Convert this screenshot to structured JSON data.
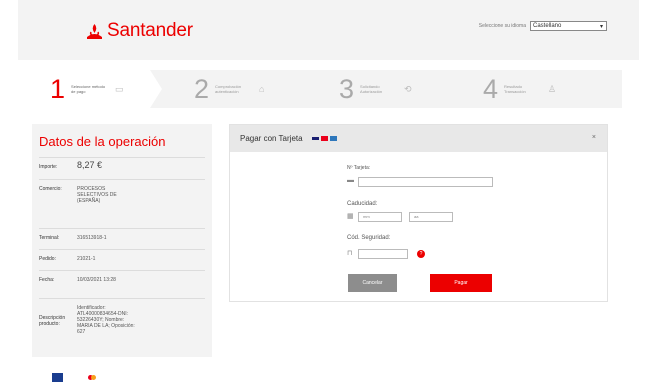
{
  "header": {
    "brand": "Santander",
    "language_label": "Seleccione su idioma",
    "language_value": "Castellano",
    "brand_color": "#ec0000"
  },
  "steps": [
    {
      "number": "1",
      "text": "Seleccione método de pago",
      "icon": "card-icon",
      "active": true
    },
    {
      "number": "2",
      "text": "Comprobación autenticación",
      "icon": "lock-icon",
      "active": false
    },
    {
      "number": "3",
      "text": "Solicitando Autorización",
      "icon": "refresh-icon",
      "active": false
    },
    {
      "number": "4",
      "text": "Resultado Transacción",
      "icon": "thumbs-up-icon",
      "active": false
    }
  ],
  "operation": {
    "title": "Datos de la operación",
    "rows": [
      {
        "label": "Importe:",
        "value": "8,27 €"
      },
      {
        "label": "Comercio:",
        "value": "PROCESOS SELECTIVOS DE (ESPAÑA)"
      },
      {
        "label": "Terminal:",
        "value": "316513918-1"
      },
      {
        "label": "Pedido:",
        "value": "21021-1"
      },
      {
        "label": "Fecha:",
        "value": "10/03/2021  13:28"
      },
      {
        "label": "Descripción producto:",
        "value": "Identificador: ATL40000834654-DNI: 53226430Y; Nombre: MARIA DE LA; Oposición: 627"
      }
    ]
  },
  "payment": {
    "title": "Pagar con Tarjeta",
    "card_number_label": "Nº Tarjeta:",
    "card_number_value": "",
    "expiry_label": "Caducidad:",
    "expiry_month_placeholder": "mm",
    "expiry_year_placeholder": "aa",
    "cvv_label": "Cód. Seguridad:",
    "cvv_value": "",
    "cancel_label": "Cancelar",
    "pay_label": "Pagar",
    "close_icon": "×"
  },
  "colors": {
    "accent": "#ec0000",
    "panel": "#f3f3f3",
    "cancel": "#8d8d8d"
  }
}
